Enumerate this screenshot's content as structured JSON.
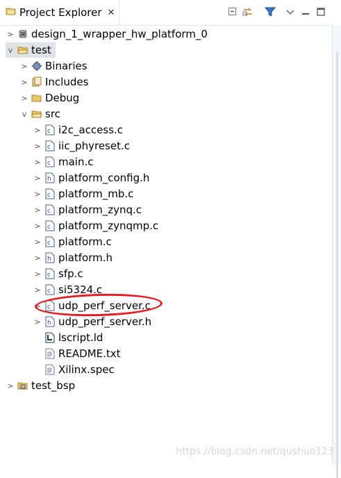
{
  "view": {
    "title": "Project Explorer",
    "close_glyph": "✕"
  },
  "toolbar": {
    "collapse_all": "collapse-all-icon",
    "link_with_editor": "link-with-editor-icon",
    "filter": "filter-icon",
    "view_menu": "view-menu-icon",
    "minimize": "minimize-icon",
    "maximize": "maximize-icon"
  },
  "tree": {
    "design": {
      "label": "design_1_wrapper_hw_platform_0"
    },
    "test": {
      "label": "test"
    },
    "binaries": {
      "label": "Binaries"
    },
    "includes": {
      "label": "Includes"
    },
    "debug": {
      "label": "Debug"
    },
    "src": {
      "label": "src"
    },
    "files": [
      {
        "label": "i2c_access.c",
        "type": "c"
      },
      {
        "label": "iic_phyreset.c",
        "type": "c"
      },
      {
        "label": "main.c",
        "type": "c"
      },
      {
        "label": "platform_config.h",
        "type": "h"
      },
      {
        "label": "platform_mb.c",
        "type": "c"
      },
      {
        "label": "platform_zynq.c",
        "type": "c"
      },
      {
        "label": "platform_zynqmp.c",
        "type": "c"
      },
      {
        "label": "platform.c",
        "type": "c"
      },
      {
        "label": "platform.h",
        "type": "h"
      },
      {
        "label": "sfp.c",
        "type": "c"
      },
      {
        "label": "si5324.c",
        "type": "c"
      },
      {
        "label": "udp_perf_server.c",
        "type": "c"
      },
      {
        "label": "udp_perf_server.h",
        "type": "h"
      }
    ],
    "lscript": {
      "label": "lscript.ld"
    },
    "readme": {
      "label": "README.txt"
    },
    "spec": {
      "label": "Xilinx.spec"
    },
    "test_bsp": {
      "label": "test_bsp"
    }
  },
  "watermark": "https://blog.csdn.net/qushuo123",
  "annotation": {
    "color": "#e51c23",
    "target": "udp_perf_server.c"
  }
}
